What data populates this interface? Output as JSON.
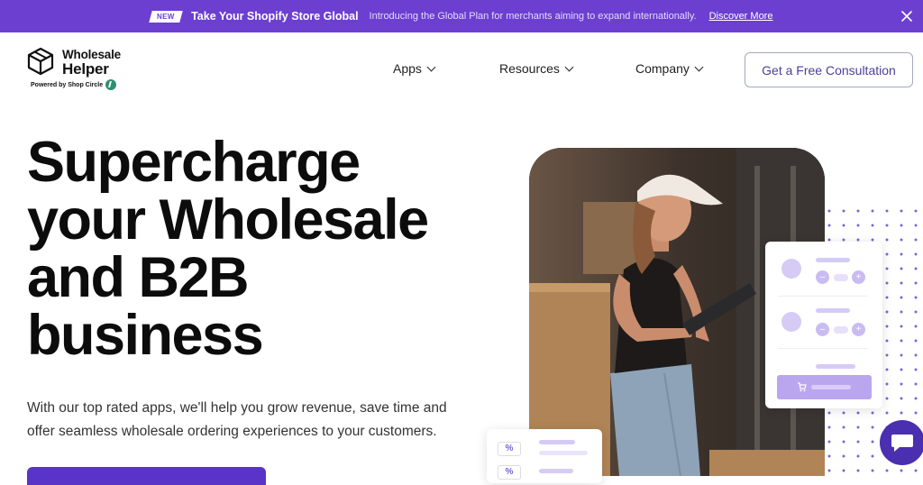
{
  "announcement": {
    "badge": "NEW",
    "headline": "Take Your Shopify Store Global",
    "description": "Introducing the Global Plan for merchants aiming to expand internationally.",
    "cta": "Discover More",
    "close_icon": "close-icon"
  },
  "logo": {
    "line1": "Wholesale",
    "line2": "Helper",
    "powered": "Powered by Shop Circle",
    "icon": "cube-icon"
  },
  "nav": {
    "items": [
      {
        "label": "Apps"
      },
      {
        "label": "Resources"
      },
      {
        "label": "Company"
      }
    ],
    "cta": "Get a Free Consultation"
  },
  "hero": {
    "title_lines": [
      "Supercharge",
      "your Wholesale",
      "and B2B",
      "business"
    ],
    "subtitle_line1": "With our top rated apps, we'll help you grow revenue, save time and",
    "subtitle_line2": "offer seamless wholesale ordering experiences to your customers."
  },
  "cards": {
    "percent_symbol": "%"
  },
  "colors": {
    "brand": "#6c3fd1",
    "button": "#5a34c8",
    "chat": "#4a2fb0"
  }
}
